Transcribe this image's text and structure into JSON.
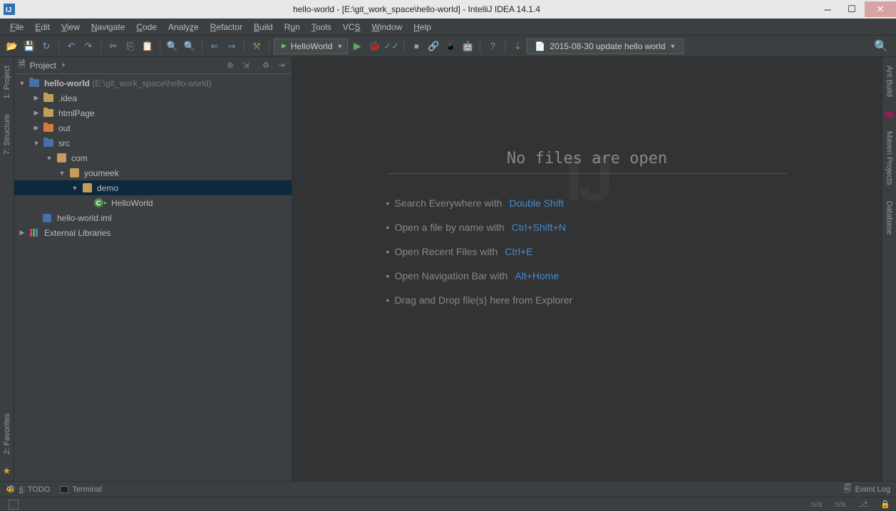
{
  "window": {
    "title": "hello-world - [E:\\git_work_space\\hello-world] - IntelliJ IDEA 14.1.4"
  },
  "menu": {
    "items": [
      "File",
      "Edit",
      "View",
      "Navigate",
      "Code",
      "Analyze",
      "Refactor",
      "Build",
      "Run",
      "Tools",
      "VCS",
      "Window",
      "Help"
    ]
  },
  "toolbar": {
    "run_config": "HelloWorld",
    "vcs_info": "2015-08-30 update hello world"
  },
  "left_tools": {
    "project": "1: Project",
    "structure": "7: Structure",
    "favorites": "2: Favorites"
  },
  "right_tools": {
    "ant": "Ant Build",
    "maven": "Maven Projects",
    "database": "Database"
  },
  "project_panel": {
    "title": "Project"
  },
  "tree": {
    "root": {
      "name": "hello-world",
      "path": "(E:\\git_work_space\\hello-world)"
    },
    "idea": ".idea",
    "htmlPage": "htmlPage",
    "out": "out",
    "src": "src",
    "com": "com",
    "youmeek": "youmeek",
    "demo": "demo",
    "helloWorld": "HelloWorld",
    "iml": "hello-world.iml",
    "ext": "External Libraries"
  },
  "editor": {
    "title": "No files are open",
    "hints": [
      {
        "text": "Search Everywhere with",
        "shortcut": "Double Shift"
      },
      {
        "text": "Open a file by name with",
        "shortcut": "Ctrl+Shift+N"
      },
      {
        "text": "Open Recent Files with",
        "shortcut": "Ctrl+E"
      },
      {
        "text": "Open Navigation Bar with",
        "shortcut": "Alt+Home"
      },
      {
        "text": "Drag and Drop file(s) here from Explorer",
        "shortcut": ""
      }
    ]
  },
  "bottom": {
    "todo": "6: TODO",
    "terminal": "Terminal",
    "eventlog": "Event Log"
  },
  "status": {
    "na1": "n/a",
    "na2": "n/a"
  }
}
